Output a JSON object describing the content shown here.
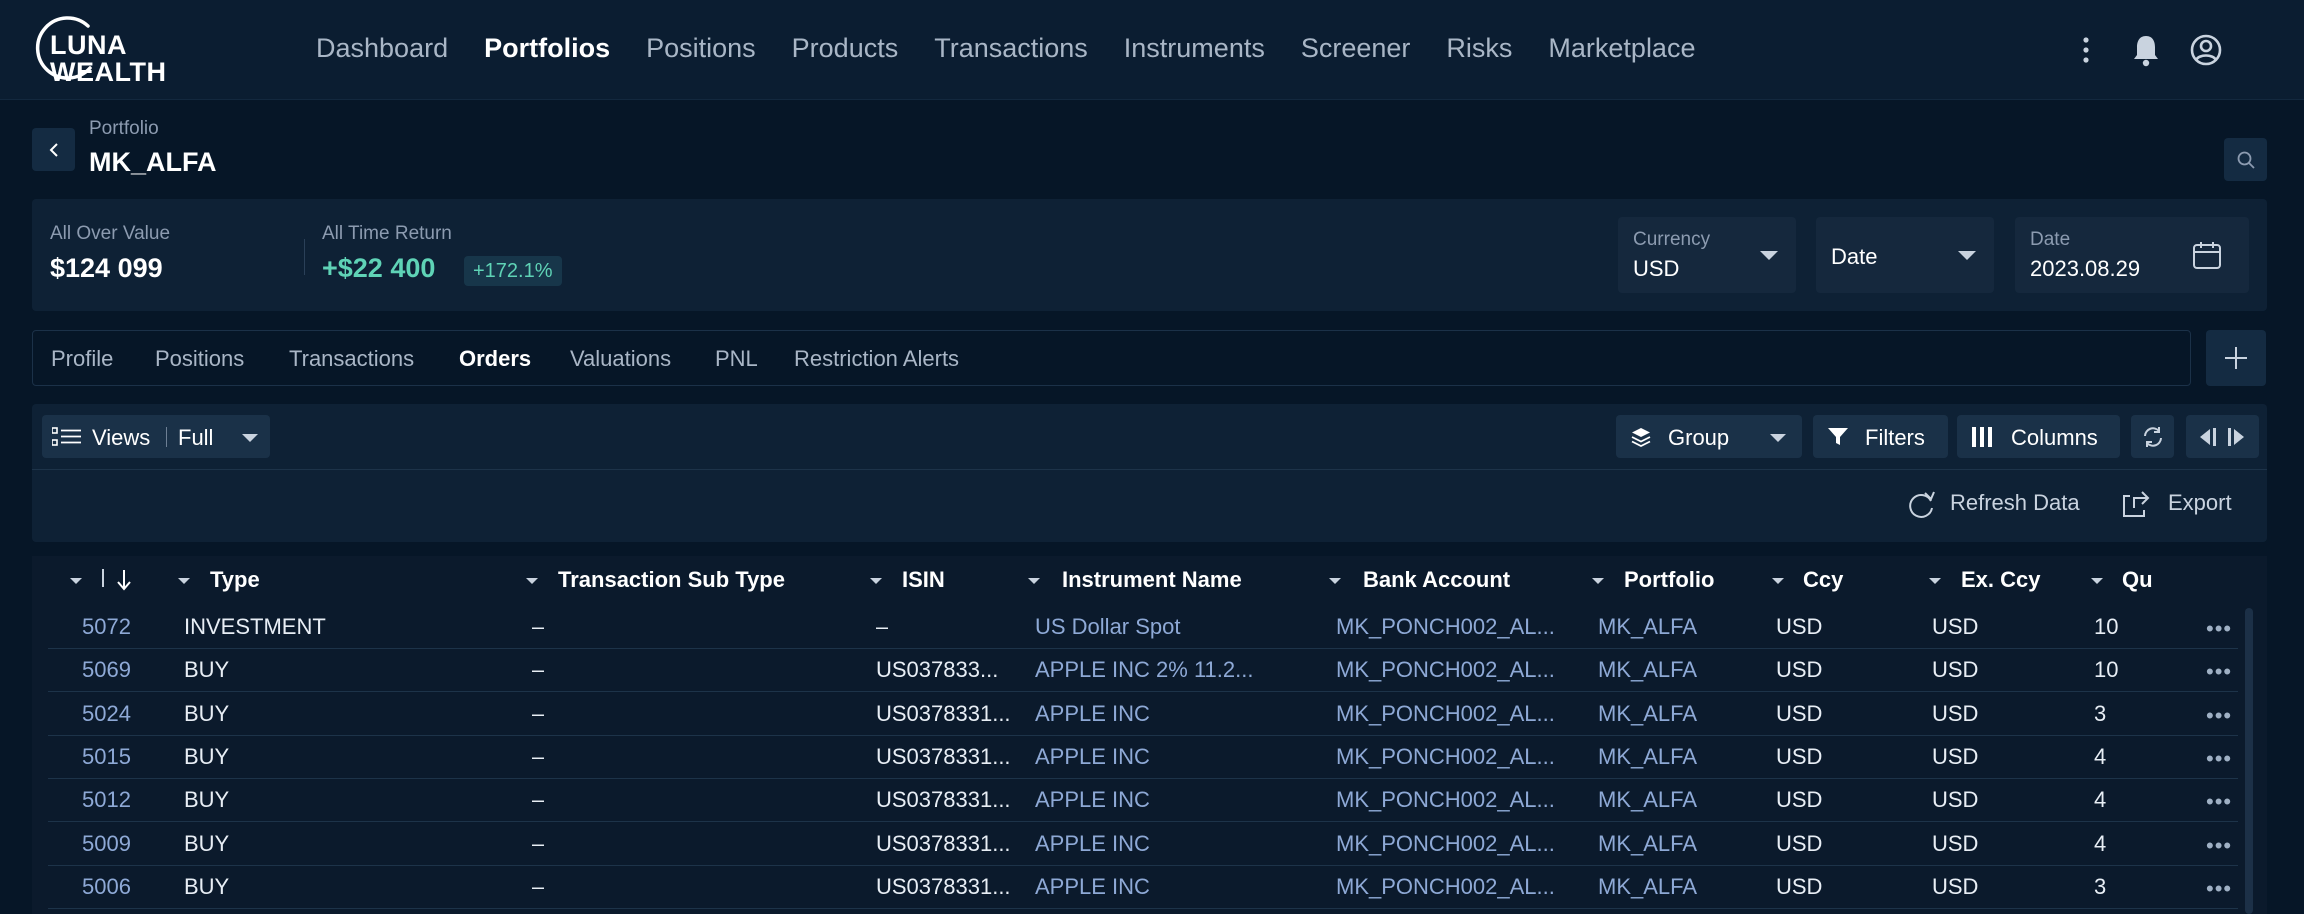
{
  "brand": {
    "line1": "LUNA",
    "line2": "WEALTH"
  },
  "nav": [
    "Dashboard",
    "Portfolios",
    "Positions",
    "Products",
    "Transactions",
    "Instruments",
    "Screener",
    "Risks",
    "Marketplace"
  ],
  "nav_active": "Portfolios",
  "top_icons": [
    "more-vertical-icon",
    "bell-icon",
    "user-circle-icon"
  ],
  "header": {
    "breadcrumb": "Portfolio",
    "title": "MK_ALFA"
  },
  "summary": {
    "value_label": "All Over Value",
    "value": "$124 099",
    "return_label": "All Time Return",
    "return_value": "+$22 400",
    "return_pct": "+172.1%",
    "currency_label": "Currency",
    "currency_value": "USD",
    "date_mode": "Date",
    "date_label": "Date",
    "date_value": "2023.08.29"
  },
  "tabs": [
    "Profile",
    "Positions",
    "Transactions",
    "Orders",
    "Valuations",
    "PNL",
    "Restriction Alerts"
  ],
  "tab_active": "Orders",
  "toolbar": {
    "views_label": "Views",
    "views_value": "Full",
    "group_label": "Group",
    "filters_label": "Filters",
    "columns_label": "Columns",
    "refresh_label": "Refresh Data",
    "export_label": "Export"
  },
  "table": {
    "columns": [
      "Type",
      "Transaction Sub Type",
      "ISIN",
      "Instrument Name",
      "Bank Account",
      "Portfolio",
      "Ccy",
      "Ex. Ccy",
      "Qu"
    ],
    "rows": [
      [
        "5072",
        "INVESTMENT",
        "–",
        "–",
        "US Dollar Spot",
        "MK_PONCH002_AL...",
        "MK_ALFA",
        "USD",
        "USD",
        "10"
      ],
      [
        "5069",
        "BUY",
        "–",
        "US037833...",
        "APPLE INC 2% 11.2...",
        "MK_PONCH002_AL...",
        "MK_ALFA",
        "USD",
        "USD",
        "10"
      ],
      [
        "5024",
        "BUY",
        "–",
        "US0378331...",
        "APPLE INC",
        "MK_PONCH002_AL...",
        "MK_ALFA",
        "USD",
        "USD",
        "3"
      ],
      [
        "5015",
        "BUY",
        "–",
        "US0378331...",
        "APPLE INC",
        "MK_PONCH002_AL...",
        "MK_ALFA",
        "USD",
        "USD",
        "4"
      ],
      [
        "5012",
        "BUY",
        "–",
        "US0378331...",
        "APPLE INC",
        "MK_PONCH002_AL...",
        "MK_ALFA",
        "USD",
        "USD",
        "4"
      ],
      [
        "5009",
        "BUY",
        "–",
        "US0378331...",
        "APPLE INC",
        "MK_PONCH002_AL...",
        "MK_ALFA",
        "USD",
        "USD",
        "4"
      ],
      [
        "5006",
        "BUY",
        "–",
        "US0378331...",
        "APPLE INC",
        "MK_PONCH002_AL...",
        "MK_ALFA",
        "USD",
        "USD",
        "3"
      ]
    ],
    "row_menu_glyph": "•••"
  },
  "colors": {
    "background": "#061627",
    "topbar": "#0b1d31",
    "panel": "#0e2135",
    "accent_green": "#5fd3b6",
    "link_blue": "#8ea9d6"
  }
}
